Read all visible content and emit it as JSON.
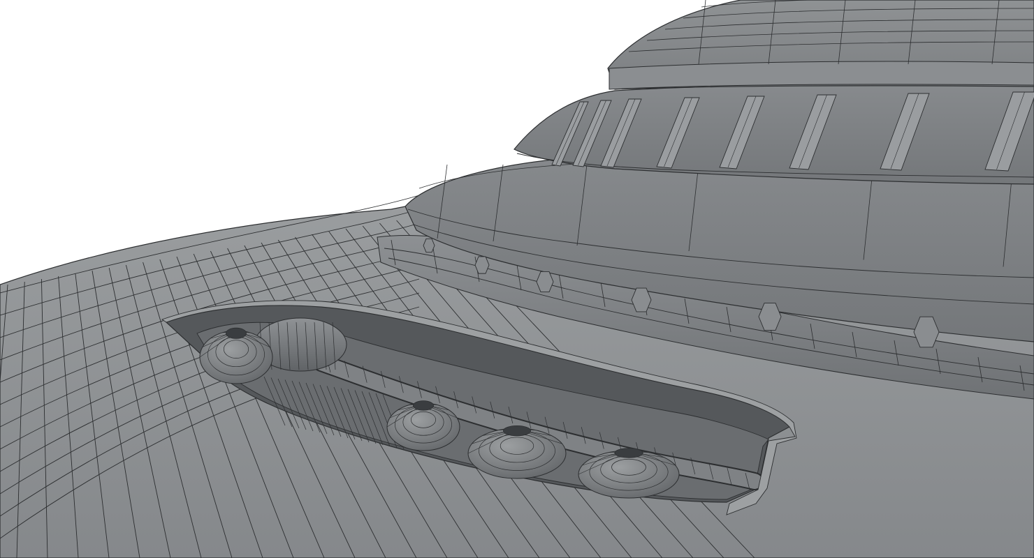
{
  "scene": {
    "kind": "wireframe-render",
    "subject": "saucer-hull-section",
    "colors": {
      "background": "#ffffff",
      "hull_light": "#8e9193",
      "hull_mid": "#7e8184",
      "hull_dark": "#5e6164",
      "recess": "#55585b",
      "wire": "#2c2e30",
      "highlight": "#a9acae"
    },
    "icons": [
      "dome-icon",
      "pipe-icon",
      "pod-icon"
    ]
  }
}
